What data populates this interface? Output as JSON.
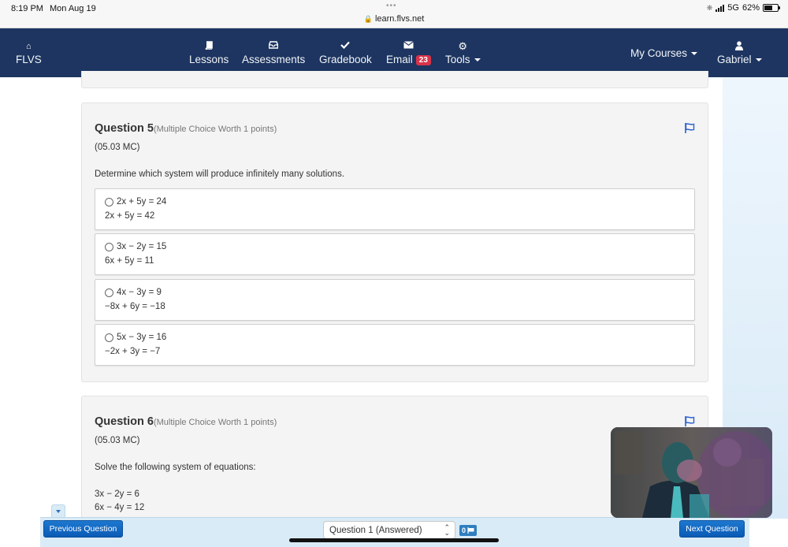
{
  "status_bar": {
    "time": "8:19 PM",
    "date": "Mon Aug 19",
    "dots": "•••",
    "url": "learn.flvs.net",
    "network": "5G",
    "battery_percent": "62%",
    "battery_level": 0.62
  },
  "navbar": {
    "brand": {
      "label": "FLVS",
      "icon": "home-icon"
    },
    "items": [
      {
        "label": "Lessons",
        "icon": "book-icon"
      },
      {
        "label": "Assessments",
        "icon": "inbox-icon"
      },
      {
        "label": "Gradebook",
        "icon": "check-icon"
      },
      {
        "label": "Email",
        "icon": "envelope-icon",
        "badge": "23"
      },
      {
        "label": "Tools",
        "icon": "gear-icon",
        "dropdown": true
      }
    ],
    "my_courses": "My Courses",
    "user": {
      "label": "Gabriel",
      "icon": "user-icon"
    }
  },
  "questions": [
    {
      "title": "Question 5",
      "subtitle": "(Multiple Choice Worth 1 points)",
      "code": "(05.03 MC)",
      "prompt": "Determine which system will produce infinitely many solutions.",
      "options": [
        {
          "line1": "2x + 5y = 24",
          "line2": "2x + 5y = 42"
        },
        {
          "line1": "3x − 2y = 15",
          "line2": "6x + 5y = 11"
        },
        {
          "line1": "4x − 3y = 9",
          "line2": "−8x + 6y = −18"
        },
        {
          "line1": "5x − 3y = 16",
          "line2": "−2x + 3y = −7"
        }
      ]
    },
    {
      "title": "Question 6",
      "subtitle": "(Multiple Choice Worth 1 points)",
      "code": "(05.03 MC)",
      "prompt": "Solve the following system of equations:",
      "equations": [
        "3x − 2y = 6",
        "6x − 4y = 12"
      ]
    }
  ],
  "bottom_bar": {
    "previous_label": "Previous Question",
    "next_label": "Next Question",
    "selected_question": "Question 1 (Answered)",
    "flag_count": "0"
  },
  "colors": {
    "navbar": "#1d3560",
    "badge": "#d9334a",
    "flag": "#2a5fd1",
    "button": "#0b5bb5"
  }
}
